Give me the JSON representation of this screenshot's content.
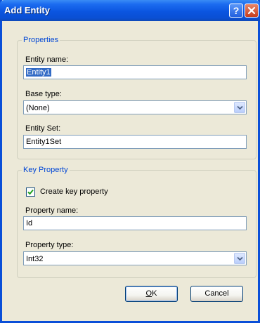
{
  "window": {
    "title": "Add Entity"
  },
  "properties": {
    "legend": "Properties",
    "entity_name_label": "Entity name:",
    "entity_name_value": "Entity1",
    "base_type_label": "Base type:",
    "base_type_value": "(None)",
    "entity_set_label": "Entity Set:",
    "entity_set_value": "Entity1Set"
  },
  "key_property": {
    "legend": "Key Property",
    "create_key_label": "Create key property",
    "create_key_checked": true,
    "property_name_label": "Property name:",
    "property_name_value": "Id",
    "property_type_label": "Property type:",
    "property_type_value": "Int32"
  },
  "buttons": {
    "ok_accel": "O",
    "ok_rest": "K",
    "cancel_label": "Cancel"
  },
  "colors": {
    "titlebar": "#0b55e0",
    "group_legend": "#0046d5",
    "selection": "#316ac5",
    "dialog_bg": "#ece9d8"
  }
}
